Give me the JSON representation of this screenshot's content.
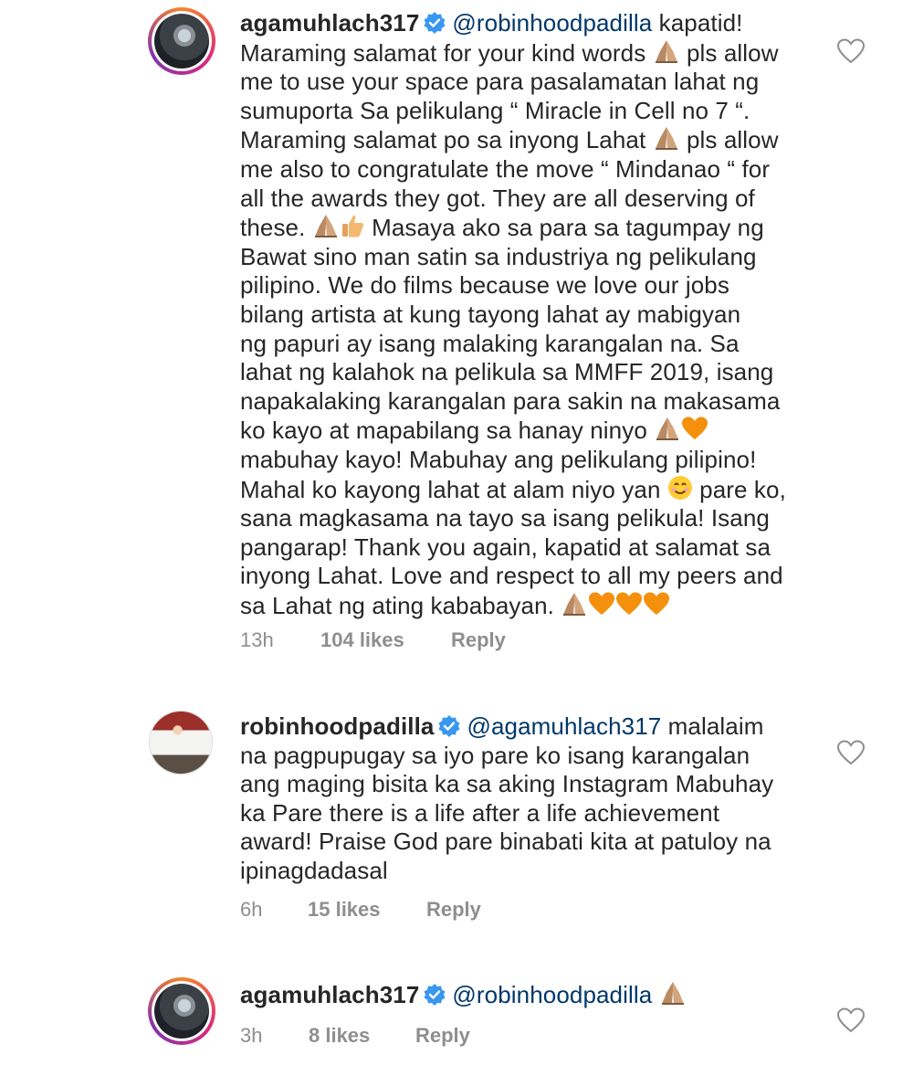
{
  "colors": {
    "mention": "#00376b",
    "meta": "#8e8e8e",
    "verified": "#3897f0",
    "text": "#262626"
  },
  "comments": [
    {
      "username": "agamuhlach317",
      "mention": "@robinhoodpadilla",
      "lines": [
        [
          " kapatid!"
        ],
        [
          "Maraming salamat for your kind words ",
          "pray-emoji",
          " pls allow"
        ],
        [
          "me to use your space para pasalamatan lahat ng"
        ],
        [
          "sumuporta Sa pelikulang “ Miracle in Cell no 7 “."
        ],
        [
          "Maraming salamat po sa inyong Lahat ",
          "pray-emoji",
          " pls allow"
        ],
        [
          "me also to congratulate the move “ Mindanao “ for"
        ],
        [
          "all the awards they got. They are all deserving of"
        ],
        [
          "these. ",
          "pray-emoji",
          "thumbs-up-emoji",
          " Masaya ako sa para sa tagumpay ng"
        ],
        [
          "Bawat sino man satin sa industriya ng pelikulang"
        ],
        [
          "pilipino. We do films because we love our jobs"
        ],
        [
          "bilang artista at kung tayong lahat ay mabigyan"
        ],
        [
          "ng papuri ay isang malaking karangalan na. Sa"
        ],
        [
          "lahat ng kalahok na pelikula sa MMFF 2019, isang"
        ],
        [
          "napakalaking karangalan para sakin na makasama"
        ],
        [
          "ko kayo at mapabilang sa hanay ninyo ",
          "pray-emoji",
          "orange-heart-emoji"
        ],
        [
          "mabuhay kayo! Mabuhay ang pelikulang pilipino!"
        ],
        [
          "Mahal ko kayong lahat at alam niyo yan ",
          "smile-emoji",
          " pare ko,"
        ],
        [
          "sana magkasama na tayo sa isang pelikula! Isang"
        ],
        [
          "pangarap! Thank you again, kapatid at salamat sa"
        ],
        [
          "inyong Lahat. Love and respect to all my peers and"
        ],
        [
          "sa Lahat ng ating kababayan. ",
          "pray-emoji",
          "orange-heart-emoji",
          "orange-heart-emoji",
          "orange-heart-emoji"
        ]
      ],
      "time": "13h",
      "likes": "104 likes",
      "reply": "Reply"
    },
    {
      "username": "robinhoodpadilla",
      "mention": "@agamuhlach317",
      "lines": [
        [
          " malalaim"
        ],
        [
          "na pagpupugay sa iyo pare ko isang karangalan"
        ],
        [
          "ang maging bisita ka sa aking Instagram Mabuhay"
        ],
        [
          "ka Pare there is a life after a life achievement"
        ],
        [
          "award! Praise God pare binabati kita at patuloy na"
        ],
        [
          "ipinagdadasal"
        ]
      ],
      "time": "6h",
      "likes": "15 likes",
      "reply": "Reply"
    },
    {
      "username": "agamuhlach317",
      "mention": "@robinhoodpadilla",
      "lines": [
        [
          " ",
          "pray-emoji"
        ]
      ],
      "time": "3h",
      "likes": "8 likes",
      "reply": "Reply"
    }
  ]
}
